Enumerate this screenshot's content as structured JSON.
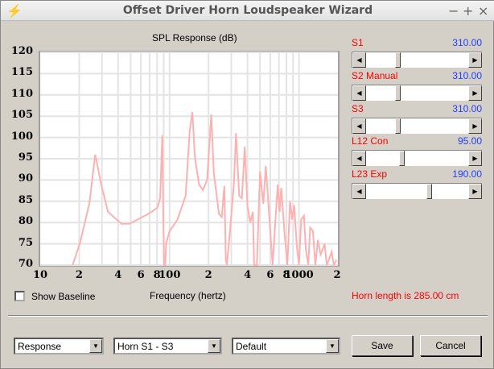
{
  "window": {
    "title": "Offset Driver Horn Loudspeaker Wizard",
    "minimize": "−",
    "maximize": "+",
    "close": "×"
  },
  "chart_data": {
    "type": "line",
    "title": "SPL Response (dB)",
    "xlabel": "Frequency (hertz)",
    "ylabel": "",
    "xscale": "log",
    "xlim": [
      10,
      2000
    ],
    "ylim": [
      70,
      120
    ],
    "grid": true,
    "color": "#ffb0b0",
    "yticks": [
      "120",
      "115",
      "110",
      "105",
      "100",
      "95",
      "90",
      "85",
      "80",
      "75",
      "70"
    ],
    "xticks": [
      {
        "v": 10,
        "label": "10"
      },
      {
        "v": 20,
        "label": "2"
      },
      {
        "v": 40,
        "label": "4"
      },
      {
        "v": 60,
        "label": "6"
      },
      {
        "v": 80,
        "label": "8"
      },
      {
        "v": 100,
        "label": "100"
      },
      {
        "v": 200,
        "label": "2"
      },
      {
        "v": 400,
        "label": "4"
      },
      {
        "v": 600,
        "label": "6"
      },
      {
        "v": 800,
        "label": "8"
      },
      {
        "v": 1000,
        "label": "1000"
      },
      {
        "v": 2000,
        "label": "2"
      }
    ],
    "series": [
      {
        "name": "SPL",
        "x": [
          17.8,
          20.2,
          24,
          26.6,
          29.6,
          33.4,
          42.4,
          48.9,
          68.2,
          80.6,
          84.5,
          87.8,
          89.4,
          90.8,
          92.5,
          94,
          100,
          115,
          133,
          143,
          150,
          157,
          169,
          181,
          195,
          210,
          220,
          241,
          253,
          265,
          272,
          277,
          292,
          314,
          326,
          345,
          362,
          381,
          400,
          420,
          440,
          450,
          473,
          500,
          530,
          554,
          596,
          625,
          685,
          708,
          730,
          776,
          814,
          853,
          886,
          918,
          963,
          1000,
          1040,
          1092,
          1130,
          1180,
          1220,
          1280,
          1340,
          1400,
          1470,
          1580,
          1640,
          1790,
          1860,
          1950
        ],
        "y": [
          70,
          75,
          84.5,
          96,
          89,
          82.5,
          79.7,
          79.7,
          82,
          83.5,
          85.7,
          100.5,
          80.7,
          70,
          70,
          75,
          78,
          80.7,
          86.3,
          101.5,
          106,
          95.2,
          88.9,
          87.6,
          90.1,
          105.4,
          91.4,
          82,
          81.3,
          88.6,
          71.2,
          70,
          77.5,
          89,
          101,
          86.3,
          85.7,
          97.8,
          83.8,
          80,
          82.5,
          70,
          70,
          92,
          84.4,
          93.3,
          79.4,
          70,
          88.9,
          82.5,
          88.2,
          76.9,
          70,
          85,
          80.7,
          84.1,
          74.4,
          70,
          80.7,
          81.6,
          73.7,
          70,
          78.8,
          78.1,
          70,
          75.9,
          72.5,
          75,
          70,
          73.1,
          70,
          71.2
        ]
      }
    ]
  },
  "params": [
    {
      "name": "S1",
      "mode": "",
      "value": "310.00",
      "position": 0.3
    },
    {
      "name": "S2",
      "mode": "Manual",
      "value": "310.00",
      "position": 0.3
    },
    {
      "name": "S3",
      "mode": "",
      "value": "310.00",
      "position": 0.3
    },
    {
      "name": "L12",
      "mode": "Con",
      "value": "95.00",
      "position": 0.34
    },
    {
      "name": "L23",
      "mode": "Exp",
      "value": "190.00",
      "position": 0.62
    }
  ],
  "show_baseline": {
    "label": "Show Baseline",
    "checked": false
  },
  "horn_length": "Horn length is 285.00 cm",
  "combos": {
    "view": "Response",
    "horn": "Horn S1 - S3",
    "preset": "Default"
  },
  "buttons": {
    "save": "Save",
    "cancel": "Cancel"
  }
}
